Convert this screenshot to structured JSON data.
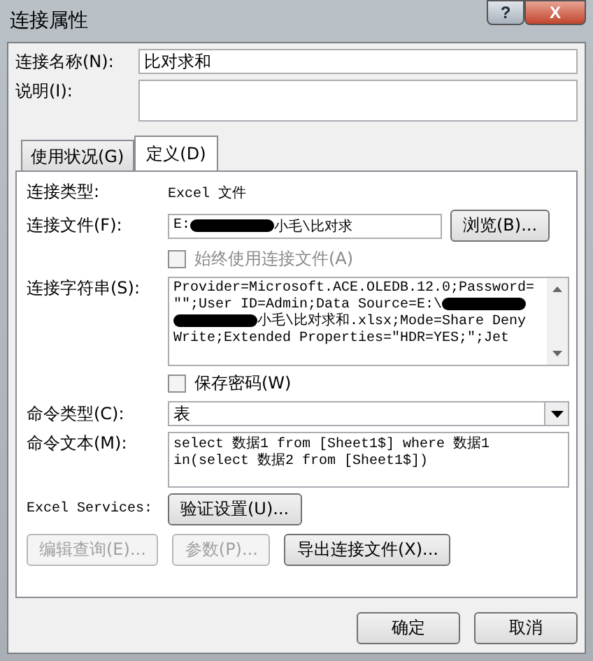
{
  "window": {
    "title": "连接属性",
    "buttons": [
      "?",
      "X"
    ]
  },
  "name": {
    "label": "连接名称(N):",
    "value": "比对求和"
  },
  "description": {
    "label": "说明(I):"
  },
  "tabs": [
    {
      "label": "使用状况(G)",
      "selected": false
    },
    {
      "label": "定义(D)",
      "selected": true
    }
  ],
  "definition": {
    "connection_type": {
      "label": "连接类型:",
      "value": "Excel 文件"
    },
    "connection_file": {
      "label": "连接文件(F):",
      "segments": [
        {
          "kind": "text",
          "text": "E:"
        },
        {
          "kind": "redacted"
        },
        {
          "kind": "text",
          "text": "小毛\\比对求"
        }
      ],
      "button": "浏览(B)..."
    },
    "always_use_file": {
      "label": "始终使用连接文件(A)",
      "checked": false,
      "disabled": true
    },
    "connection_string": {
      "label": "连接字符串(S):",
      "lines": [
        [
          {
            "kind": "text",
            "text": "Provider=Microsoft.ACE.OLEDB.12.0;Password="
          }
        ],
        [
          {
            "kind": "text",
            "text": "\"\";User ID=Admin;Data Source=E:\\"
          },
          {
            "kind": "redacted"
          }
        ],
        [
          {
            "kind": "redacted"
          },
          {
            "kind": "text",
            "text": "小毛\\比对求和.xlsx;Mode=Share Deny"
          }
        ],
        [
          {
            "kind": "text",
            "text": "Write;Extended Properties=\"HDR=YES;\";Jet"
          }
        ]
      ]
    },
    "save_password": {
      "label": "保存密码(W)",
      "checked": false,
      "disabled": false
    },
    "command_type": {
      "label": "命令类型(C):",
      "value": "表"
    },
    "command_text": {
      "label": "命令文本(M):",
      "lines": [
        "select 数据1 from [Sheet1$] where 数据1",
        "in(select 数据2 from [Sheet1$])"
      ]
    },
    "excel_services": {
      "label": "Excel Services:",
      "button": "验证设置(U)..."
    },
    "actions": [
      {
        "label": "编辑查询(E)...",
        "disabled": true
      },
      {
        "label": "参数(P)...",
        "disabled": true
      },
      {
        "label": "导出连接文件(X)...",
        "disabled": false
      }
    ]
  },
  "footer_buttons": [
    "确定",
    "取消"
  ]
}
